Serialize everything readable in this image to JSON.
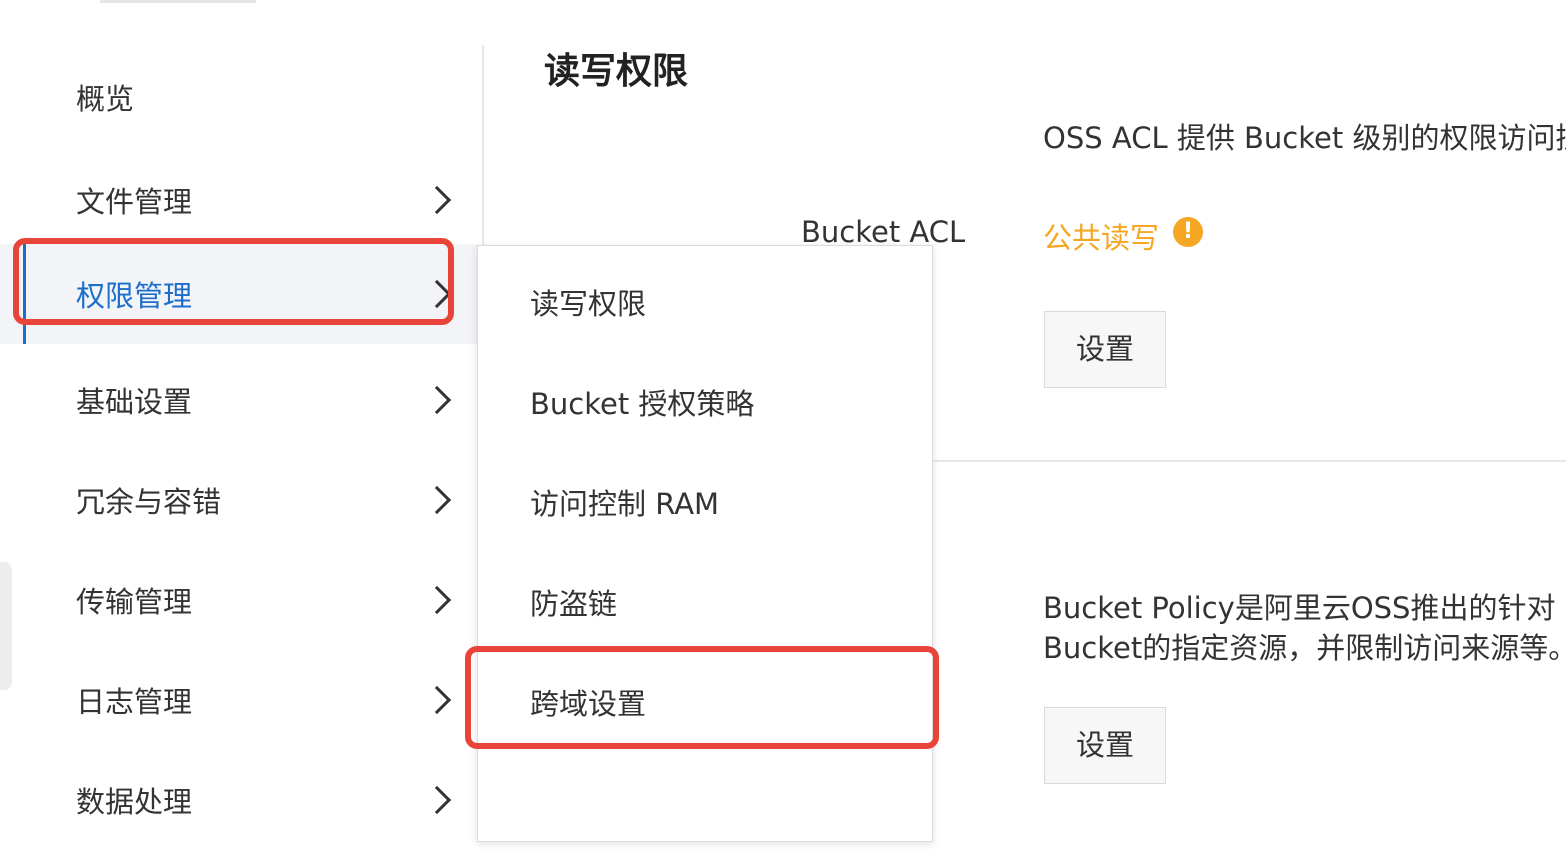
{
  "sidebar": {
    "items": [
      {
        "label": "概览",
        "has_arrow": false
      },
      {
        "label": "文件管理",
        "has_arrow": true
      },
      {
        "label": "权限管理",
        "has_arrow": true,
        "active": true
      },
      {
        "label": "基础设置",
        "has_arrow": true
      },
      {
        "label": "冗余与容错",
        "has_arrow": true
      },
      {
        "label": "传输管理",
        "has_arrow": true
      },
      {
        "label": "日志管理",
        "has_arrow": true
      },
      {
        "label": "数据处理",
        "has_arrow": true
      }
    ]
  },
  "submenu": {
    "items": [
      {
        "label": "读写权限"
      },
      {
        "label": "Bucket 授权策略"
      },
      {
        "label": "访问控制 RAM"
      },
      {
        "label": "防盗链"
      },
      {
        "label": "跨域设置",
        "highlighted": true
      }
    ]
  },
  "main": {
    "title": "读写权限",
    "acl": {
      "description": "OSS ACL 提供 Bucket 级别的权限访问控",
      "label": "Bucket ACL",
      "value": "公共读写",
      "warning_icon": "exclamation-circle-icon",
      "button": "设置"
    },
    "policy": {
      "description_line1": "Bucket Policy是阿里云OSS推出的针对",
      "description_line2": "Bucket的指定资源，并限制访问来源等。",
      "button": "设置"
    }
  },
  "colors": {
    "accent": "#1d6ecb",
    "warning": "#f5a623",
    "highlight": "#e8443a"
  }
}
